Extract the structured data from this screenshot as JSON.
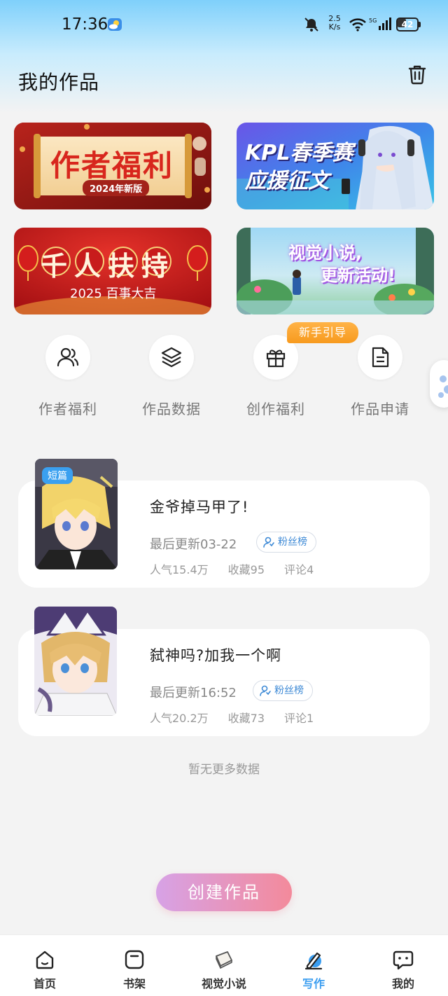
{
  "status_bar": {
    "time": "17:36",
    "net_speed_value": "2.5",
    "net_speed_unit": "K/s",
    "network": "5G",
    "battery": "42",
    "battery_level": 0.42
  },
  "header": {
    "title": "我的作品"
  },
  "banners": [
    {
      "title": "作者福利",
      "subtitle": "2024年新版"
    },
    {
      "title_line1": "KPL春季赛",
      "title_line2": "应援征文"
    },
    {
      "title": "千人扶持",
      "subtitle": "2025 百事大吉"
    },
    {
      "title_line1": "视觉小说,",
      "title_line2": "更新活动!"
    }
  ],
  "shortcuts": [
    {
      "label": "作者福利",
      "icon": "users-icon"
    },
    {
      "label": "作品数据",
      "icon": "layers-icon"
    },
    {
      "label": "创作福利",
      "icon": "gift-icon"
    },
    {
      "label": "作品申请",
      "icon": "document-icon"
    }
  ],
  "guide_badge": "新手引导",
  "works": [
    {
      "tag": "短篇",
      "title": "金爷掉马甲了!",
      "updated": "最后更新03-22",
      "fans_label": "粉丝榜",
      "popularity": "人气15.4万",
      "favorites": "收藏95",
      "comments": "评论4"
    },
    {
      "tag": "",
      "title": "弑神吗?加我一个啊",
      "updated": "最后更新16:52",
      "fans_label": "粉丝榜",
      "popularity": "人气20.2万",
      "favorites": "收藏73",
      "comments": "评论1"
    }
  ],
  "no_more_text": "暂无更多数据",
  "create_button": "创建作品",
  "nav": {
    "items": [
      {
        "label": "首页",
        "icon": "home-icon"
      },
      {
        "label": "书架",
        "icon": "bookshelf-icon"
      },
      {
        "label": "视觉小说",
        "icon": "book-icon"
      },
      {
        "label": "写作",
        "icon": "write-icon",
        "active": true
      },
      {
        "label": "我的",
        "icon": "chat-icon"
      }
    ],
    "active_color": "#3a9df0"
  },
  "colors": {
    "accent_blue": "#3aa0f0",
    "badge_orange": "#f79a1e",
    "create_gradient_start": "#d7a2e6",
    "create_gradient_end": "#f38a9b"
  }
}
